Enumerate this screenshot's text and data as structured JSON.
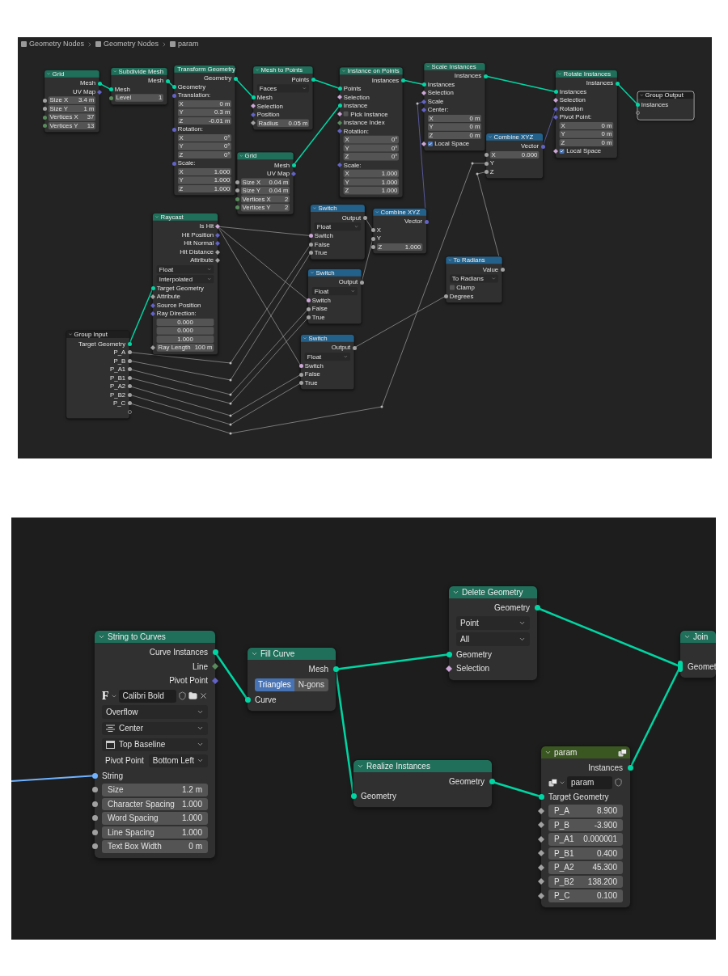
{
  "breadcrumb": [
    "Geometry Nodes",
    "Geometry Nodes",
    "param"
  ],
  "editors": [
    {
      "nodes": [
        {
          "title": "Grid",
          "kind": "geometry",
          "selected": false,
          "rows": [
            {
              "kind": "output",
              "label": "Mesh",
              "color": "#00d6a3",
              "field_socket": false
            },
            {
              "kind": "output",
              "label": "UV Map",
              "color": "#6363c7",
              "field_socket": true
            },
            {
              "kind": "field",
              "label": "Size X",
              "value": "3.4 m",
              "color": "#a1a1a1",
              "field_socket": false
            },
            {
              "kind": "field",
              "label": "Size Y",
              "value": "1 m",
              "color": "#a1a1a1",
              "field_socket": false
            },
            {
              "kind": "field",
              "label": "Vertices X",
              "value": "37",
              "color": "#598c5c",
              "field_socket": false
            },
            {
              "kind": "field",
              "label": "Vertices Y",
              "value": "13",
              "color": "#598c5c",
              "field_socket": false
            }
          ]
        },
        {
          "title": "Subdivide Mesh",
          "kind": "geometry",
          "selected": false,
          "rows": [
            {
              "kind": "output",
              "label": "Mesh",
              "color": "#00d6a3",
              "field_socket": false
            },
            {
              "kind": "input",
              "label": "Mesh",
              "color": "#00d6a3",
              "field_socket": false
            },
            {
              "kind": "field",
              "label": "Level",
              "value": "1",
              "color": "#598c5c",
              "field_socket": false
            }
          ]
        },
        {
          "title": "Transform Geometry",
          "kind": "geometry",
          "selected": false,
          "rows": [
            {
              "kind": "output",
              "label": "Geometry",
              "color": "#00d6a3",
              "field_socket": false
            },
            {
              "kind": "input",
              "label": "Geometry",
              "color": "#00d6a3",
              "field_socket": false
            },
            {
              "kind": "input",
              "label": "Translation:",
              "color": "#6363c7",
              "field_socket": false
            },
            {
              "kind": "field",
              "label": "X",
              "value": "0 m"
            },
            {
              "kind": "field",
              "label": "Y",
              "value": "0.3 m"
            },
            {
              "kind": "field",
              "label": "Z",
              "value": "-0.01 m"
            },
            {
              "kind": "input",
              "label": "Rotation:",
              "color": "#6363c7",
              "field_socket": false
            },
            {
              "kind": "field",
              "label": "X",
              "value": "0°"
            },
            {
              "kind": "field",
              "label": "Y",
              "value": "0°"
            },
            {
              "kind": "field",
              "label": "Z",
              "value": "0°"
            },
            {
              "kind": "input",
              "label": "Scale:",
              "color": "#6363c7",
              "field_socket": false
            },
            {
              "kind": "field",
              "label": "X",
              "value": "1.000"
            },
            {
              "kind": "field",
              "label": "Y",
              "value": "1.000"
            },
            {
              "kind": "field",
              "label": "Z",
              "value": "1.000"
            }
          ]
        },
        {
          "title": "Mesh to Points",
          "kind": "geometry",
          "selected": false,
          "rows": [
            {
              "kind": "output",
              "label": "Points",
              "color": "#00d6a3",
              "field_socket": false
            },
            {
              "kind": "dropdown",
              "value": "Faces"
            },
            {
              "kind": "input",
              "label": "Mesh",
              "color": "#00d6a3",
              "field_socket": false
            },
            {
              "kind": "input",
              "label": "Selection",
              "color": "#cca6d6",
              "field_socket": true
            },
            {
              "kind": "input",
              "label": "Position",
              "color": "#6363c7",
              "field_socket": true
            },
            {
              "kind": "field",
              "label": "Radius",
              "value": "0.05 m",
              "color": "#a1a1a1",
              "field_socket": true
            }
          ]
        },
        {
          "title": "Instance on Points",
          "kind": "geometry",
          "selected": false,
          "rows": [
            {
              "kind": "output",
              "label": "Instances",
              "color": "#00d6a3",
              "field_socket": false
            },
            {
              "kind": "input",
              "label": "Points",
              "color": "#00d6a3",
              "field_socket": false
            },
            {
              "kind": "input",
              "label": "Selection",
              "color": "#cca6d6",
              "field_socket": true
            },
            {
              "kind": "input",
              "label": "Instance",
              "color": "#00d6a3",
              "field_socket": false
            },
            {
              "kind": "checkbox",
              "label": "Pick Instance",
              "checked": false,
              "color": "#cca6d6",
              "field_socket": true
            },
            {
              "kind": "input",
              "label": "Instance Index",
              "color": "#598c5c",
              "field_socket": true
            },
            {
              "kind": "input",
              "label": "Rotation:",
              "color": "#6363c7",
              "field_socket": true
            },
            {
              "kind": "field",
              "label": "X",
              "value": "0°"
            },
            {
              "kind": "field",
              "label": "Y",
              "value": "0°"
            },
            {
              "kind": "field",
              "label": "Z",
              "value": "0°"
            },
            {
              "kind": "input",
              "label": "Scale:",
              "color": "#6363c7",
              "field_socket": true
            },
            {
              "kind": "field",
              "label": "X",
              "value": "1.000"
            },
            {
              "kind": "field",
              "label": "Y",
              "value": "1.000"
            },
            {
              "kind": "field",
              "label": "Z",
              "value": "1.000"
            }
          ]
        },
        {
          "title": "Scale Instances",
          "kind": "geometry",
          "selected": false,
          "rows": [
            {
              "kind": "output",
              "label": "Instances",
              "color": "#00d6a3",
              "field_socket": false
            },
            {
              "kind": "input",
              "label": "Instances",
              "color": "#00d6a3",
              "field_socket": false
            },
            {
              "kind": "input",
              "label": "Selection",
              "color": "#cca6d6",
              "field_socket": true
            },
            {
              "kind": "input",
              "label": "Scale",
              "color": "#6363c7",
              "field_socket": true
            },
            {
              "kind": "input",
              "label": "Center:",
              "color": "#6363c7",
              "field_socket": true
            },
            {
              "kind": "field",
              "label": "X",
              "value": "0 m"
            },
            {
              "kind": "field",
              "label": "Y",
              "value": "0 m"
            },
            {
              "kind": "field",
              "label": "Z",
              "value": "0 m"
            },
            {
              "kind": "checkbox",
              "label": "Local Space",
              "checked": true,
              "color": "#cca6d6",
              "field_socket": true
            }
          ]
        },
        {
          "title": "Rotate Instances",
          "kind": "geometry",
          "selected": false,
          "rows": [
            {
              "kind": "output",
              "label": "Instances",
              "color": "#00d6a3",
              "field_socket": false
            },
            {
              "kind": "input",
              "label": "Instances",
              "color": "#00d6a3",
              "field_socket": false
            },
            {
              "kind": "input",
              "label": "Selection",
              "color": "#cca6d6",
              "field_socket": true
            },
            {
              "kind": "input",
              "label": "Rotation",
              "color": "#6363c7",
              "field_socket": true
            },
            {
              "kind": "input",
              "label": "Pivot Point:",
              "color": "#6363c7",
              "field_socket": true
            },
            {
              "kind": "field",
              "label": "X",
              "value": "0 m"
            },
            {
              "kind": "field",
              "label": "Y",
              "value": "0 m"
            },
            {
              "kind": "field",
              "label": "Z",
              "value": "0 m"
            },
            {
              "kind": "checkbox",
              "label": "Local Space",
              "checked": true,
              "color": "#cca6d6",
              "field_socket": true
            }
          ]
        },
        {
          "title": "Group Output",
          "kind": "group-io",
          "selected": true,
          "rows": [
            {
              "kind": "input",
              "label": "Instances",
              "color": "#00d6a3",
              "field_socket": false
            },
            {
              "kind": "empty-input"
            }
          ]
        },
        {
          "title": "Grid",
          "kind": "geometry",
          "selected": false,
          "rows": [
            {
              "kind": "output",
              "label": "Mesh",
              "color": "#00d6a3",
              "field_socket": false
            },
            {
              "kind": "output",
              "label": "UV Map",
              "color": "#6363c7",
              "field_socket": true
            },
            {
              "kind": "field",
              "label": "Size X",
              "value": "0.04 m",
              "color": "#a1a1a1",
              "field_socket": false
            },
            {
              "kind": "field",
              "label": "Size Y",
              "value": "0.04 m",
              "color": "#a1a1a1",
              "field_socket": false
            },
            {
              "kind": "field",
              "label": "Vertices X",
              "value": "2",
              "color": "#598c5c",
              "field_socket": false
            },
            {
              "kind": "field",
              "label": "Vertices Y",
              "value": "2",
              "color": "#598c5c",
              "field_socket": false
            }
          ]
        },
        {
          "title": "Combine XYZ",
          "kind": "converter",
          "selected": false,
          "rows": [
            {
              "kind": "output",
              "label": "Vector",
              "color": "#6363c7",
              "field_socket": false
            },
            {
              "kind": "field",
              "label": "X",
              "value": "0.000",
              "color": "#a1a1a1",
              "field_socket": false
            },
            {
              "kind": "input",
              "label": "Y",
              "color": "#a1a1a1",
              "field_socket": false
            },
            {
              "kind": "input",
              "label": "Z",
              "color": "#a1a1a1",
              "field_socket": false
            }
          ]
        },
        {
          "title": "Raycast",
          "kind": "geometry",
          "selected": false,
          "rows": [
            {
              "kind": "output",
              "label": "Is Hit",
              "color": "#cca6d6",
              "field_socket": true
            },
            {
              "kind": "output",
              "label": "Hit Position",
              "color": "#6363c7",
              "field_socket": true
            },
            {
              "kind": "output",
              "label": "Hit Normal",
              "color": "#6363c7",
              "field_socket": true
            },
            {
              "kind": "output",
              "label": "Hit Distance",
              "color": "#a1a1a1",
              "field_socket": true
            },
            {
              "kind": "output",
              "label": "Attribute",
              "color": "#a1a1a1",
              "field_socket": true
            },
            {
              "kind": "dropdown",
              "value": "Float"
            },
            {
              "kind": "dropdown",
              "value": "Interpolated"
            },
            {
              "kind": "input",
              "label": "Target Geometry",
              "color": "#00d6a3",
              "field_socket": false
            },
            {
              "kind": "input",
              "label": "Attribute",
              "color": "#a1a1a1",
              "field_socket": true
            },
            {
              "kind": "input",
              "label": "Source Position",
              "color": "#6363c7",
              "field_socket": true
            },
            {
              "kind": "input",
              "label": "Ray Direction:",
              "color": "#6363c7",
              "field_socket": true
            },
            {
              "kind": "value-field",
              "value": "0.000"
            },
            {
              "kind": "value-field",
              "value": "0.000"
            },
            {
              "kind": "value-field",
              "value": "1.000"
            },
            {
              "kind": "field",
              "label": "Ray Length",
              "value": "100 m",
              "color": "#a1a1a1",
              "field_socket": true
            }
          ]
        },
        {
          "title": "Switch",
          "kind": "converter",
          "selected": false,
          "rows": [
            {
              "kind": "output",
              "label": "Output",
              "color": "#a1a1a1",
              "field_socket": false
            },
            {
              "kind": "dropdown",
              "value": "Float"
            },
            {
              "kind": "input",
              "label": "Switch",
              "color": "#cca6d6",
              "field_socket": false
            },
            {
              "kind": "input",
              "label": "False",
              "color": "#a1a1a1",
              "field_socket": false
            },
            {
              "kind": "input",
              "label": "True",
              "color": "#a1a1a1",
              "field_socket": false
            }
          ]
        },
        {
          "title": "Combine XYZ",
          "kind": "converter",
          "selected": false,
          "rows": [
            {
              "kind": "output",
              "label": "Vector",
              "color": "#6363c7",
              "field_socket": false
            },
            {
              "kind": "input",
              "label": "X",
              "color": "#a1a1a1",
              "field_socket": false
            },
            {
              "kind": "input",
              "label": "Y",
              "color": "#a1a1a1",
              "field_socket": false
            },
            {
              "kind": "field",
              "label": "Z",
              "value": "1.000",
              "color": "#a1a1a1",
              "field_socket": false
            }
          ]
        },
        {
          "title": "Switch",
          "kind": "converter",
          "selected": false,
          "rows": [
            {
              "kind": "output",
              "label": "Output",
              "color": "#a1a1a1",
              "field_socket": false
            },
            {
              "kind": "dropdown",
              "value": "Float"
            },
            {
              "kind": "input",
              "label": "Switch",
              "color": "#cca6d6",
              "field_socket": false
            },
            {
              "kind": "input",
              "label": "False",
              "color": "#a1a1a1",
              "field_socket": false
            },
            {
              "kind": "input",
              "label": "True",
              "color": "#a1a1a1",
              "field_socket": false
            }
          ]
        },
        {
          "title": "To Radians",
          "kind": "converter",
          "selected": false,
          "rows": [
            {
              "kind": "output",
              "label": "Value",
              "color": "#a1a1a1",
              "field_socket": false
            },
            {
              "kind": "dropdown",
              "value": "To Radians"
            },
            {
              "kind": "checkbox",
              "label": "Clamp",
              "checked": false
            },
            {
              "kind": "input",
              "label": "Degrees",
              "color": "#a1a1a1",
              "field_socket": false
            }
          ]
        },
        {
          "title": "Switch",
          "kind": "converter",
          "selected": false,
          "rows": [
            {
              "kind": "output",
              "label": "Output",
              "color": "#a1a1a1",
              "field_socket": false
            },
            {
              "kind": "dropdown",
              "value": "Float"
            },
            {
              "kind": "input",
              "label": "Switch",
              "color": "#cca6d6",
              "field_socket": false
            },
            {
              "kind": "input",
              "label": "False",
              "color": "#a1a1a1",
              "field_socket": false
            },
            {
              "kind": "input",
              "label": "True",
              "color": "#a1a1a1",
              "field_socket": false
            }
          ]
        },
        {
          "title": "Group Input",
          "kind": "group-io",
          "selected": false,
          "rows": [
            {
              "kind": "output",
              "label": "Target Geometry",
              "color": "#00d6a3",
              "field_socket": false
            },
            {
              "kind": "output",
              "label": "P_A",
              "color": "#a1a1a1",
              "field_socket": false
            },
            {
              "kind": "output",
              "label": "P_B",
              "color": "#a1a1a1",
              "field_socket": false
            },
            {
              "kind": "output",
              "label": "P_A1",
              "color": "#a1a1a1",
              "field_socket": false
            },
            {
              "kind": "output",
              "label": "P_B1",
              "color": "#a1a1a1",
              "field_socket": false
            },
            {
              "kind": "output",
              "label": "P_A2",
              "color": "#a1a1a1",
              "field_socket": false
            },
            {
              "kind": "output",
              "label": "P_B2",
              "color": "#a1a1a1",
              "field_socket": false
            },
            {
              "kind": "output",
              "label": "P_C",
              "color": "#a1a1a1",
              "field_socket": false
            },
            {
              "kind": "empty-output"
            }
          ]
        }
      ]
    },
    {
      "nodes": [
        {
          "title": "String to Curves",
          "kind": "geometry",
          "selected": false,
          "rows": [
            {
              "kind": "output",
              "label": "Curve Instances",
              "color": "#00d6a3",
              "field_socket": false
            },
            {
              "kind": "output",
              "label": "Line",
              "color": "#598c5c",
              "field_socket": true
            },
            {
              "kind": "output",
              "label": "Pivot Point",
              "color": "#6363c7",
              "field_socket": true
            },
            {
              "kind": "font",
              "glyph": "F",
              "value": "Calibri Bold"
            },
            {
              "kind": "dropdown",
              "value": "Overflow"
            },
            {
              "kind": "icon-dropdown",
              "value": "Center"
            },
            {
              "kind": "icon-dropdown",
              "value": "Top Baseline"
            },
            {
              "kind": "pair-dropdown",
              "label": "Pivot Point",
              "value": "Bottom Left"
            },
            {
              "kind": "input",
              "label": "String",
              "color": "#70b2ff",
              "field_socket": false
            },
            {
              "kind": "field",
              "label": "Size",
              "value": "1.2 m",
              "color": "#a1a1a1",
              "field_socket": false
            },
            {
              "kind": "field",
              "label": "Character Spacing",
              "value": "1.000",
              "color": "#a1a1a1",
              "field_socket": false
            },
            {
              "kind": "field",
              "label": "Word Spacing",
              "value": "1.000",
              "color": "#a1a1a1",
              "field_socket": false
            },
            {
              "kind": "field",
              "label": "Line Spacing",
              "value": "1.000",
              "color": "#a1a1a1",
              "field_socket": false
            },
            {
              "kind": "field",
              "label": "Text Box Width",
              "value": "0 m",
              "color": "#a1a1a1",
              "field_socket": false
            }
          ]
        },
        {
          "title": "Fill Curve",
          "kind": "geometry",
          "selected": false,
          "rows": [
            {
              "kind": "output",
              "label": "Mesh",
              "color": "#00d6a3",
              "field_socket": false
            },
            {
              "kind": "toggle",
              "options": [
                {
                  "label": "Triangles",
                  "selected": true
                },
                {
                  "label": "N-gons",
                  "selected": false
                }
              ]
            },
            {
              "kind": "input",
              "label": "Curve",
              "color": "#00d6a3",
              "field_socket": false
            }
          ]
        },
        {
          "title": "Delete Geometry",
          "kind": "geometry",
          "selected": false,
          "rows": [
            {
              "kind": "output",
              "label": "Geometry",
              "color": "#00d6a3",
              "field_socket": false
            },
            {
              "kind": "dropdown",
              "value": "Point"
            },
            {
              "kind": "dropdown",
              "value": "All"
            },
            {
              "kind": "input",
              "label": "Geometry",
              "color": "#00d6a3",
              "field_socket": false
            },
            {
              "kind": "input",
              "label": "Selection",
              "color": "#cca6d6",
              "field_socket": true
            }
          ]
        },
        {
          "title": "Join",
          "kind": "geometry",
          "selected": false,
          "rows": [
            {
              "kind": "blank"
            },
            {
              "kind": "multi-input",
              "label": "Geomet",
              "color": "#00d6a3"
            }
          ]
        },
        {
          "title": "Realize Instances",
          "kind": "geometry",
          "selected": false,
          "rows": [
            {
              "kind": "output",
              "label": "Geometry",
              "color": "#00d6a3",
              "field_socket": false
            },
            {
              "kind": "input",
              "label": "Geometry",
              "color": "#00d6a3",
              "field_socket": false
            }
          ]
        },
        {
          "title": "param",
          "kind": "group",
          "selected": false,
          "rows": [
            {
              "kind": "output",
              "label": "Instances",
              "color": "#00d6a3",
              "field_socket": false
            },
            {
              "kind": "datablock",
              "value": "param"
            },
            {
              "kind": "input",
              "label": "Target Geometry",
              "color": "#00d6a3",
              "field_socket": false
            },
            {
              "kind": "field",
              "label": "P_A",
              "value": "8.900",
              "color": "#a1a1a1",
              "field_socket": true
            },
            {
              "kind": "field",
              "label": "P_B",
              "value": "-3.900",
              "color": "#a1a1a1",
              "field_socket": true
            },
            {
              "kind": "field",
              "label": "P_A1",
              "value": "0.000001",
              "color": "#a1a1a1",
              "field_socket": true
            },
            {
              "kind": "field",
              "label": "P_B1",
              "value": "0.400",
              "color": "#a1a1a1",
              "field_socket": true
            },
            {
              "kind": "field",
              "label": "P_A2",
              "value": "45.300",
              "color": "#a1a1a1",
              "field_socket": true
            },
            {
              "kind": "field",
              "label": "P_B2",
              "value": "138.200",
              "color": "#a1a1a1",
              "field_socket": true
            },
            {
              "kind": "field",
              "label": "P_C",
              "value": "0.100",
              "color": "#a1a1a1",
              "field_socket": true
            }
          ]
        }
      ]
    }
  ]
}
